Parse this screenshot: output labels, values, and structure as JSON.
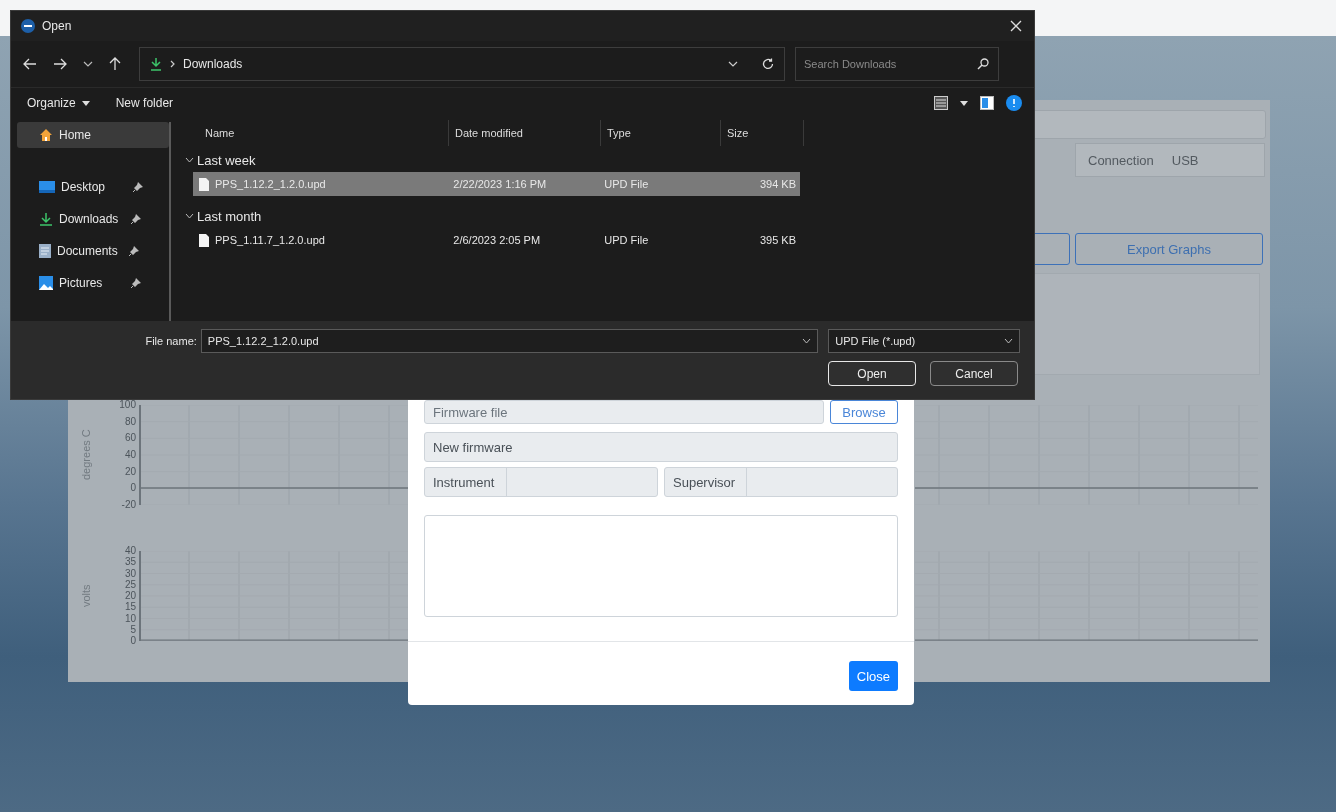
{
  "app": {
    "connection": {
      "label": "Connection",
      "value": "USB"
    },
    "export_button": "Export Graphs",
    "charts": [
      {
        "ylabel": "degrees C",
        "ticks": [
          "100",
          "80",
          "60",
          "40",
          "20",
          "0",
          "-20"
        ]
      },
      {
        "ylabel": "volts",
        "ticks": [
          "40",
          "35",
          "30",
          "25",
          "20",
          "15",
          "10",
          "5",
          "0"
        ]
      }
    ]
  },
  "firmware_modal": {
    "file_field": {
      "placeholder": "Firmware file"
    },
    "browse_button": "Browse",
    "new_firmware_label": "New firmware",
    "fields": [
      {
        "label": "Instrument"
      },
      {
        "label": "Supervisor"
      }
    ],
    "close_button": "Close"
  },
  "open_dialog": {
    "title": "Open",
    "path": [
      "Downloads"
    ],
    "search": {
      "placeholder": "Search Downloads"
    },
    "toolbar": {
      "organize": "Organize",
      "new_folder": "New folder"
    },
    "sidebar": [
      {
        "label": "Home",
        "kind": "home",
        "selected": true,
        "pinned": false
      },
      {
        "label": "Desktop",
        "kind": "desktop",
        "selected": false,
        "pinned": true
      },
      {
        "label": "Downloads",
        "kind": "downloads",
        "selected": false,
        "pinned": true
      },
      {
        "label": "Documents",
        "kind": "documents",
        "selected": false,
        "pinned": true
      },
      {
        "label": "Pictures",
        "kind": "pictures",
        "selected": false,
        "pinned": true
      }
    ],
    "columns": [
      "Name",
      "Date modified",
      "Type",
      "Size"
    ],
    "groups": [
      {
        "label": "Last week",
        "expanded": true,
        "files": [
          {
            "name": "PPS_1.12.2_1.2.0.upd",
            "date": "2/22/2023 1:16 PM",
            "type": "UPD File",
            "size": "394 KB",
            "selected": true
          }
        ]
      },
      {
        "label": "Last month",
        "expanded": true,
        "files": [
          {
            "name": "PPS_1.11.7_1.2.0.upd",
            "date": "2/6/2023 2:05 PM",
            "type": "UPD File",
            "size": "395 KB",
            "selected": false
          }
        ]
      }
    ],
    "file_name_label": "File name:",
    "file_name": "PPS_1.12.2_1.2.0.upd",
    "file_type": "UPD File (*.upd)",
    "buttons": [
      {
        "label": "Open",
        "kind": "primary"
      },
      {
        "label": "Cancel",
        "kind": "secondary"
      }
    ]
  }
}
